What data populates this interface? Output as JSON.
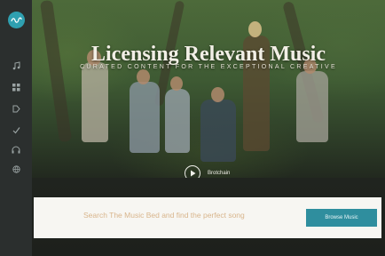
{
  "sidebar": {
    "logo_text": "",
    "items": [
      {
        "icon": "music-note-icon"
      },
      {
        "icon": "grid-icon"
      },
      {
        "icon": "tag-icon"
      },
      {
        "icon": "checkmark-icon"
      },
      {
        "icon": "headphones-icon"
      },
      {
        "icon": "globe-icon"
      }
    ]
  },
  "hero": {
    "title": "Licensing Relevant Music",
    "subtitle": "CURATED CONTENT FOR THE EXCEPTIONAL CREATIVE"
  },
  "player": {
    "track_title": "Brotchain",
    "track_artist": ""
  },
  "search": {
    "text": "Search The Music Bed and find the perfect song",
    "button_label": "Browse Music"
  },
  "colors": {
    "accent": "#2f8e9e",
    "sidebar": "#2b2f2e",
    "search_text": "#d8b58c"
  }
}
